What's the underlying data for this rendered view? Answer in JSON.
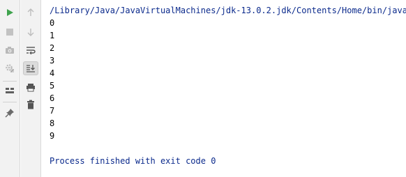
{
  "console": {
    "command": "/Library/Java/JavaVirtualMachines/jdk-13.0.2.jdk/Contents/Home/bin/java \"",
    "output": [
      "0",
      "1",
      "2",
      "3",
      "4",
      "5",
      "6",
      "7",
      "8",
      "9"
    ],
    "status": "Process finished with exit code 0"
  },
  "toolbar_left": {
    "icons": [
      "run-icon",
      "stop-icon",
      "camera-icon",
      "settings-disabled-icon",
      "layout-icon",
      "pin-icon"
    ]
  },
  "toolbar_right": {
    "icons": [
      "up-arrow-icon",
      "down-arrow-icon",
      "soft-wrap-icon",
      "scroll-to-end-icon",
      "print-icon",
      "trash-icon"
    ]
  },
  "colors": {
    "run_green": "#3fa34d",
    "console_blue": "#0b2a8c",
    "toolbar_bg": "#f2f2f2"
  }
}
